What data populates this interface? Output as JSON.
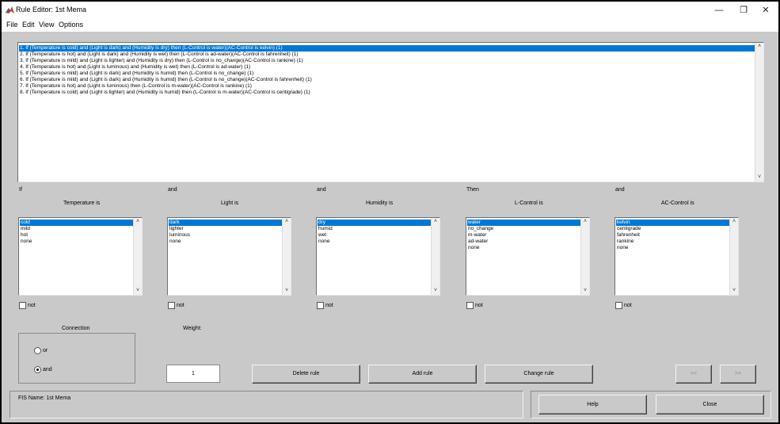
{
  "window": {
    "title": "Rule Editor: 1st Mema",
    "controls": {
      "minimize": "—",
      "maximize": "❐",
      "close": "✕"
    }
  },
  "menu": [
    "File",
    "Edit",
    "View",
    "Options"
  ],
  "rules": [
    "1. If (Temperature is cold) and (Light is dark) and (Humidity is dry) then (L-Control is water)(AC-Control is kelvin) (1)",
    "2. If (Temperature is hot) and (Light is dark) and (Humidity is wet) then (L-Control is ad-water)(AC-Control is fahrenheit) (1)",
    "3. If (Temperature is mild) and (Light is lighter) and (Humidity is dry) then (L-Control is no_change)(AC-Control is rankine) (1)",
    "4. If (Temperature is hot) and (Light is luminous) and (Humidity is wet) then (L-Control is ad-water) (1)",
    "5. If (Temperature is mild) and (Light is dark) and (Humidity is humid) then (L-Control is no_change) (1)",
    "6. If (Temperature is mild) and (Light is dark) and (Humidity is humid) then (L-Control is no_change)(AC-Control is fahrenheit) (1)",
    "7. If (Temperature is hot) and (Light is luminous) then (L-Control is m-water)(AC-Control is rankine) (1)",
    "8. If (Temperature is cold) and (Light is lighter) and (Humidity is humid) then (L-Control is m-water)(AC-Control is centigrade) (1)"
  ],
  "connectors": {
    "if": "If",
    "and1": "and",
    "and2": "and",
    "then": "Then",
    "and3": "and"
  },
  "variables": [
    {
      "title": "Temperature is",
      "items": [
        "cold",
        "mild",
        "hot",
        "none"
      ],
      "selected": 0,
      "not_label": "not"
    },
    {
      "title": "Light is",
      "items": [
        "dark",
        "lighter",
        "luminous",
        "none"
      ],
      "selected": 0,
      "not_label": "not"
    },
    {
      "title": "Humidity is",
      "items": [
        "dry",
        "humid",
        "wet",
        "none"
      ],
      "selected": 0,
      "not_label": "not"
    },
    {
      "title": "L-Control is",
      "items": [
        "water",
        "no_change",
        "m-water",
        "ad-water",
        "none"
      ],
      "selected": 0,
      "not_label": "not"
    },
    {
      "title": "AC-Control is",
      "items": [
        "kelvin",
        "centigrade",
        "fahrenheit",
        "rankine",
        "none"
      ],
      "selected": 0,
      "not_label": "not"
    }
  ],
  "connection": {
    "title": "Connection",
    "or_label": "or",
    "and_label": "and",
    "selected": "and"
  },
  "weight": {
    "label": "Weight:",
    "value": "1"
  },
  "buttons": {
    "delete_rule": "Delete rule",
    "add_rule": "Add rule",
    "change_rule": "Change rule",
    "prev": "<<",
    "next": ">>",
    "help": "Help",
    "close": "Close"
  },
  "status": {
    "fis_name": "FIS Name: 1st Mema"
  },
  "colors": {
    "background": "#c9c9c9",
    "selection": "#0078d7"
  }
}
